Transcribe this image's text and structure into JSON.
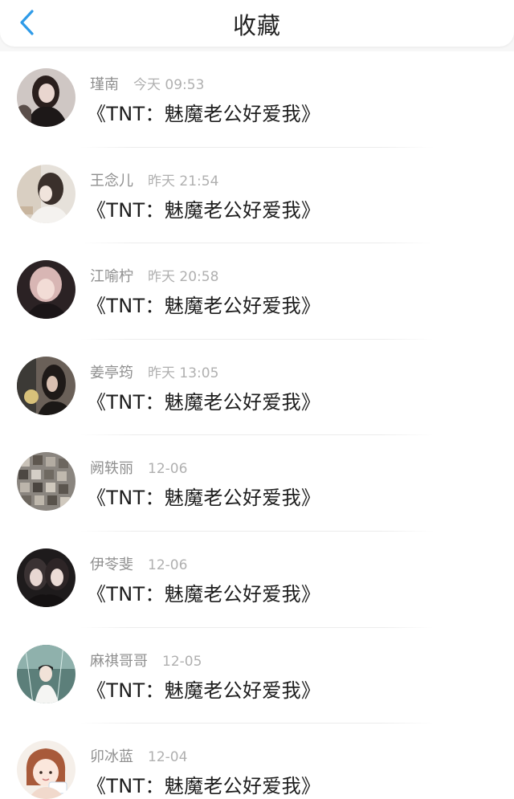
{
  "header": {
    "title": "收藏"
  },
  "items": [
    {
      "name": "瑾南",
      "time": "今天 09:53",
      "message": "《TNT：魅魔老公好爱我》"
    },
    {
      "name": "王念儿",
      "time": "昨天 21:54",
      "message": "《TNT：魅魔老公好爱我》"
    },
    {
      "name": "江喻柠",
      "time": "昨天 20:58",
      "message": "《TNT：魅魔老公好爱我》"
    },
    {
      "name": "姜亭筠",
      "time": "昨天 13:05",
      "message": "《TNT：魅魔老公好爱我》"
    },
    {
      "name": "阙轶丽",
      "time": "12-06",
      "message": "《TNT：魅魔老公好爱我》"
    },
    {
      "name": "伊苓斐",
      "time": "12-06",
      "message": "《TNT：魅魔老公好爱我》"
    },
    {
      "name": "麻祺哥哥",
      "time": "12-05",
      "message": "《TNT：魅魔老公好爱我》"
    },
    {
      "name": "卯冰蓝",
      "time": "12-04",
      "message": "《TNT：魅魔老公好爱我》"
    }
  ],
  "colors": {
    "accent_back": "#2f9be8"
  }
}
